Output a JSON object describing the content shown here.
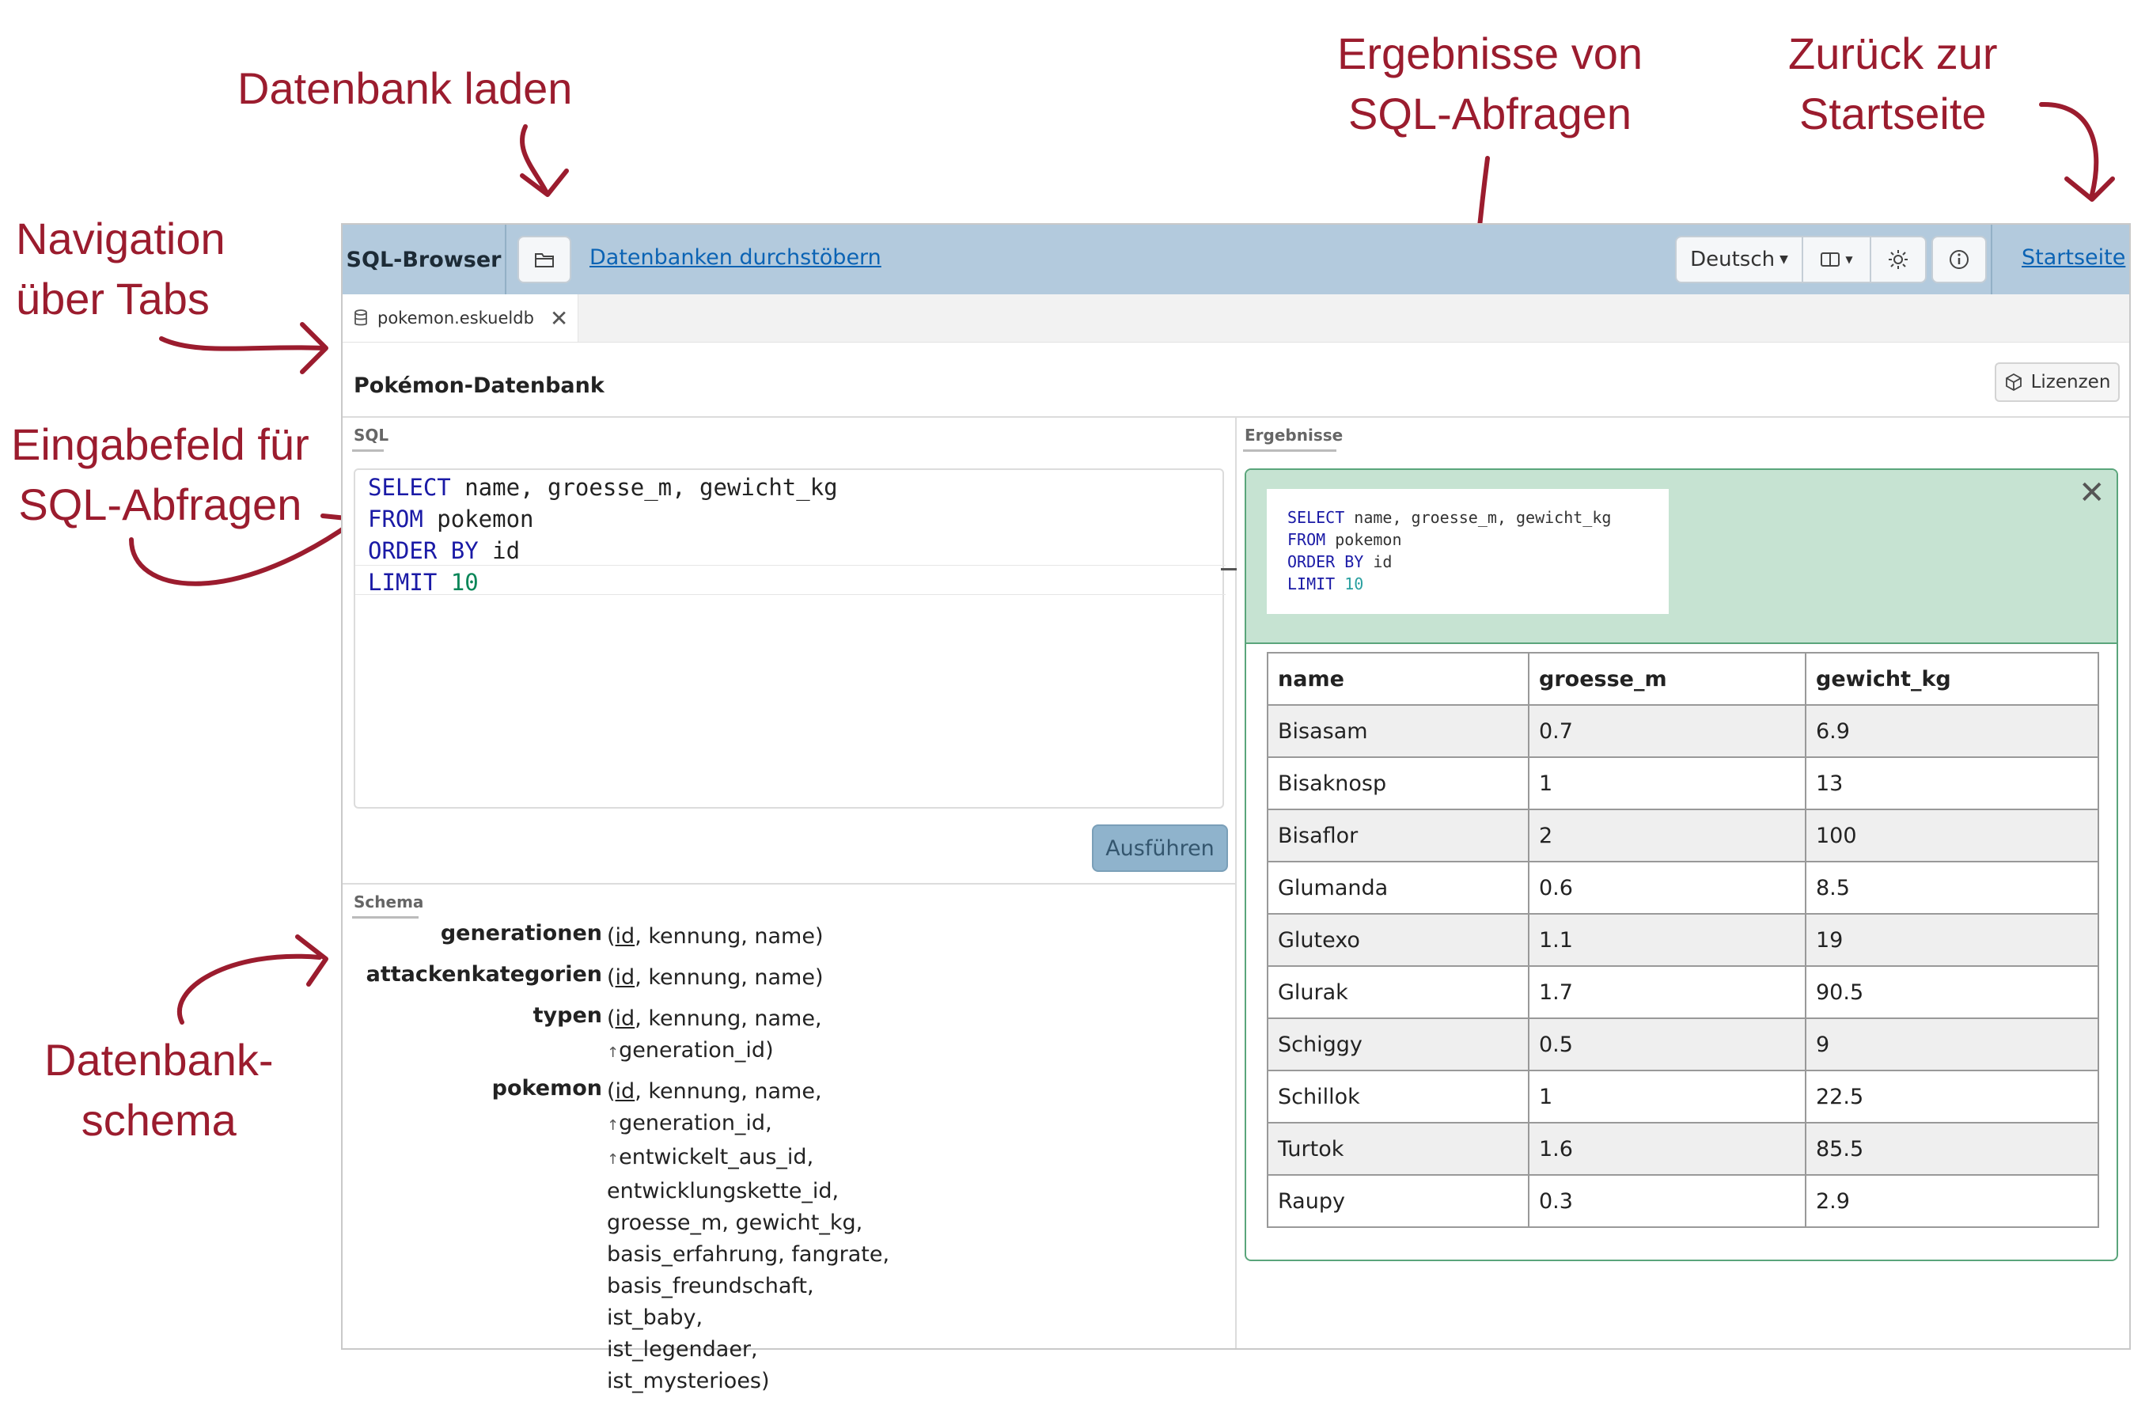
{
  "annotations": {
    "load_db": "Datenbank laden",
    "results": [
      "Ergebnisse von",
      "SQL-Abfragen"
    ],
    "home": [
      "Zurück zur",
      "Startseite"
    ],
    "tabs": [
      "Navigation",
      "über Tabs"
    ],
    "input": [
      "Eingabefeld für",
      "SQL-Abfragen"
    ],
    "schema": [
      "Datenbank-",
      "schema"
    ]
  },
  "toolbar": {
    "brand": "SQL-Browser",
    "browse_link": "Datenbanken durchstöbern",
    "language": "Deutsch",
    "home_link": "Startseite"
  },
  "tabs": [
    {
      "label": "pokemon.eskueldb"
    }
  ],
  "db_title": "Pokémon-Datenbank",
  "licenses_label": "Lizenzen",
  "sql_label": "SQL",
  "results_label": "Ergebnisse",
  "schema_label": "Schema",
  "run_label": "Ausführen",
  "query": {
    "l1_kw": "SELECT",
    "l1_rest": " name, groesse_m, gewicht_kg",
    "l2_kw": "FROM",
    "l2_rest": " pokemon",
    "l3_kw": "ORDER BY",
    "l3_rest": " id",
    "l4_kw": "LIMIT",
    "l4_num": "10"
  },
  "schema": {
    "generationen": {
      "name": "generationen",
      "pk": "id",
      "rest": ", kennung, name)"
    },
    "attackenkategorien": {
      "name": "attackenkategorien",
      "pk": "id",
      "rest": ", kennung, name)"
    },
    "typen": {
      "name": "typen",
      "pk": "id",
      "rest": ", kennung, name,",
      "fk1": "generation_id)"
    },
    "pokemon": {
      "name": "pokemon",
      "pk": "id",
      "rest": ", kennung, name,",
      "fk1": "generation_id,",
      "fk2": "entwickelt_aus_id,",
      "l4": "entwicklungskette_id,",
      "l5": "groesse_m, gewicht_kg,",
      "l6": "basis_erfahrung, fangrate,",
      "l7": "basis_freundschaft, ist_baby,",
      "l8": "ist_legendaer, ist_mysterioes)"
    }
  },
  "result_table": {
    "headers": [
      "name",
      "groesse_m",
      "gewicht_kg"
    ],
    "rows": [
      [
        "Bisasam",
        "0.7",
        "6.9"
      ],
      [
        "Bisaknosp",
        "1",
        "13"
      ],
      [
        "Bisaflor",
        "2",
        "100"
      ],
      [
        "Glumanda",
        "0.6",
        "8.5"
      ],
      [
        "Glutexo",
        "1.1",
        "19"
      ],
      [
        "Glurak",
        "1.7",
        "90.5"
      ],
      [
        "Schiggy",
        "0.5",
        "9"
      ],
      [
        "Schillok",
        "1",
        "22.5"
      ],
      [
        "Turtok",
        "1.6",
        "85.5"
      ],
      [
        "Raupy",
        "0.3",
        "2.9"
      ]
    ]
  }
}
